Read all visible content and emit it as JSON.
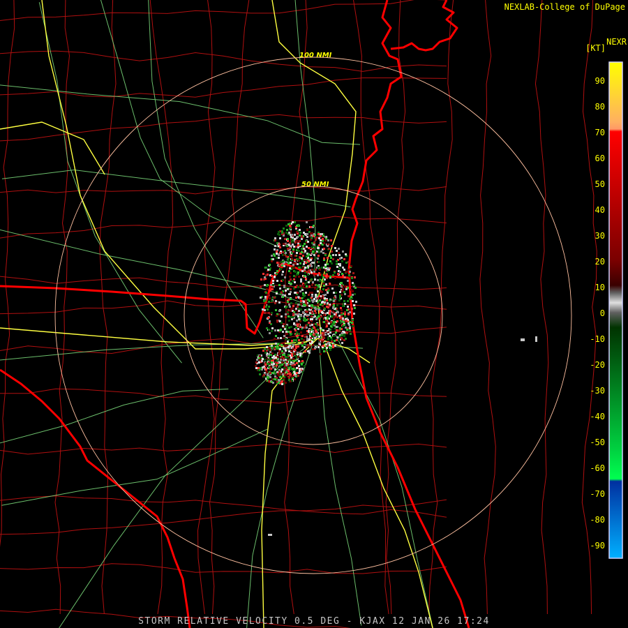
{
  "header": {
    "credit": "NEXLAB-College of DuPage",
    "product": "NEXR",
    "units": "[KT]"
  },
  "status_bar": {
    "text": "STORM RELATIVE VELOCITY 0.5 DEG - KJAX 12 JAN 26 17:24"
  },
  "range_rings": [
    {
      "label": "50 NMI"
    },
    {
      "label": "100 NMI"
    }
  ],
  "legend": {
    "ticks": [
      "90",
      "80",
      "70",
      "60",
      "50",
      "40",
      "30",
      "20",
      "10",
      "0",
      "-10",
      "-20",
      "-30",
      "-40",
      "-50",
      "-60",
      "-70",
      "-80",
      "-90"
    ],
    "colors": {
      "max": "#ffff00",
      "orange": "#ff9966",
      "red": "#ff0000",
      "dark_red": "#500000",
      "zero_gray": "#808080",
      "dark_green": "#004400",
      "green": "#00e040",
      "blue": "#0040c0",
      "light_blue": "#00a0ff"
    }
  },
  "map_colors": {
    "state_lines": "#ff0000",
    "county_lines": "#b01010",
    "interstates": "#ffff40",
    "highways": "#80ff80",
    "rings": "#ffc0a0"
  }
}
